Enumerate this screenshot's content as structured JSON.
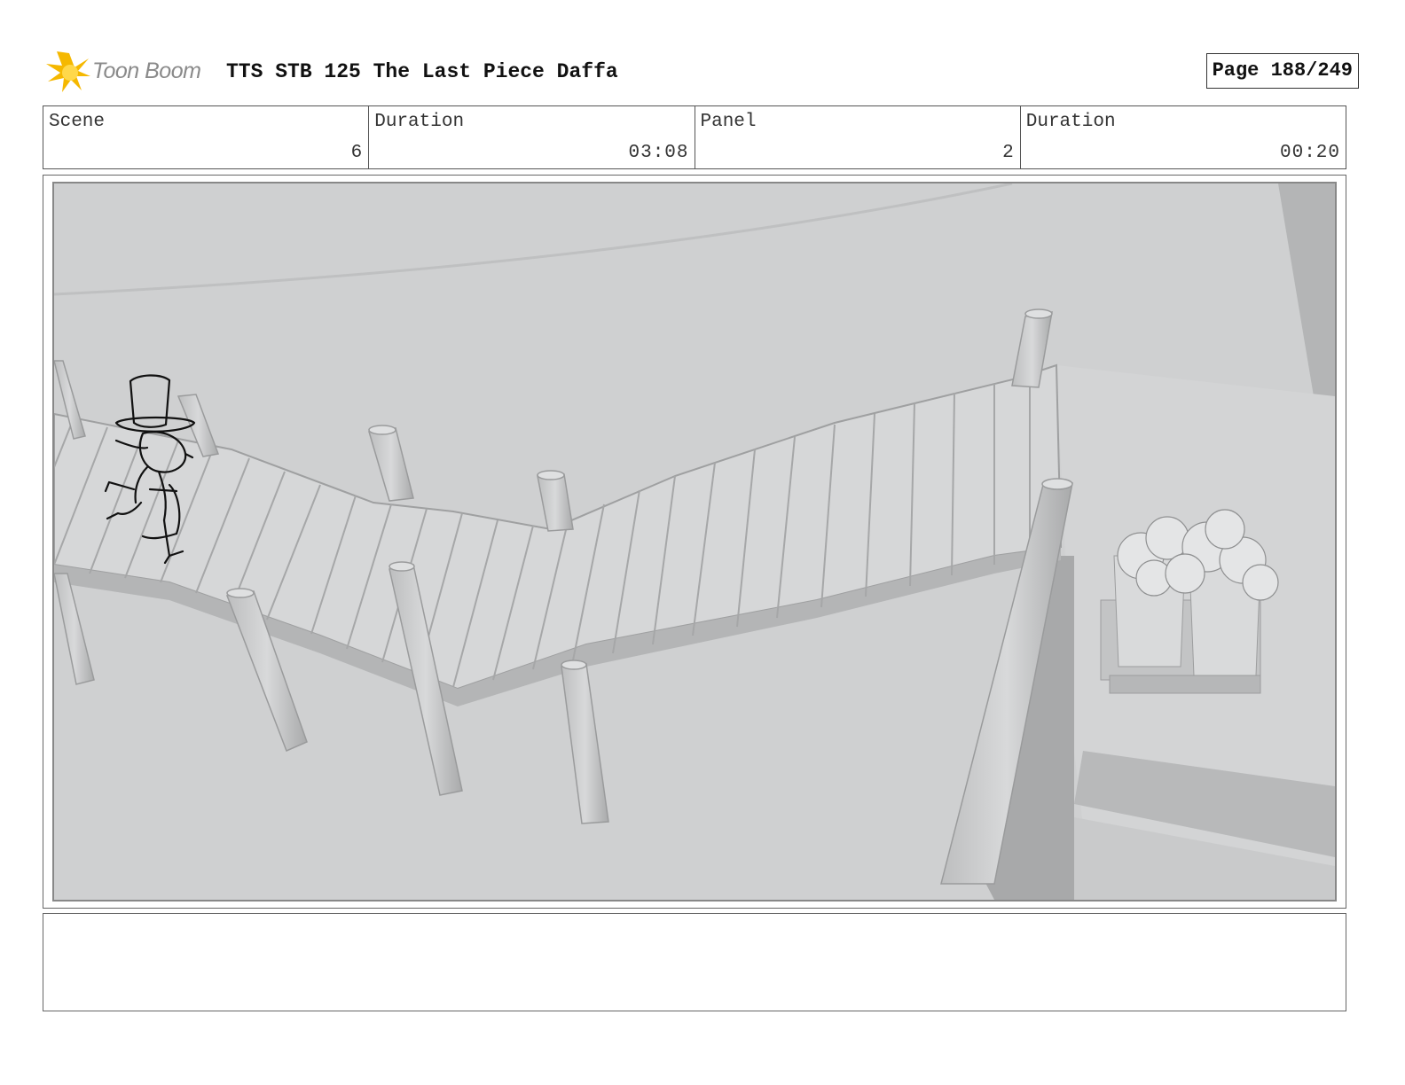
{
  "header": {
    "logo_text": "Toon Boom",
    "title": "TTS STB 125 The Last Piece Daffa",
    "page": "Page 188/249"
  },
  "info": {
    "scene_label": "Scene",
    "scene_value": "6",
    "duration_label": "Duration",
    "duration_value": "03:08",
    "panel_label": "Panel",
    "panel_value": "2",
    "panel_duration_label": "Duration",
    "panel_duration_value": "00:20"
  },
  "colors": {
    "background": "#cfd0d1",
    "logo_accent": "#f5b800"
  }
}
